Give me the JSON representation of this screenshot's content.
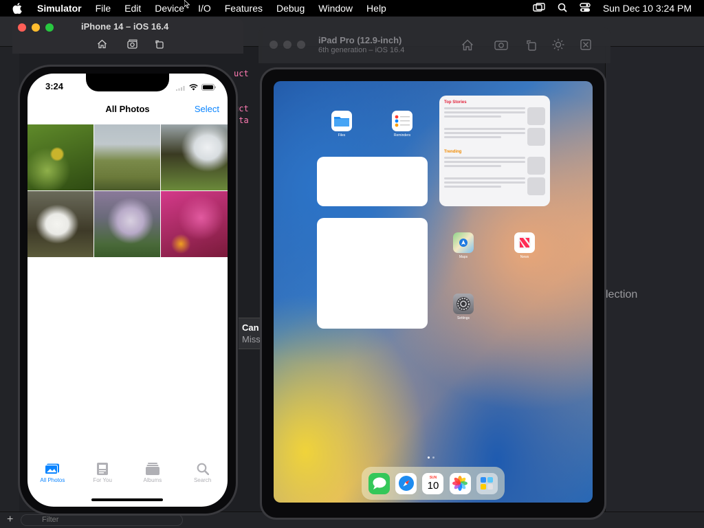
{
  "menubar": {
    "app_name": "Simulator",
    "items": [
      "File",
      "Edit",
      "Device",
      "I/O",
      "Features",
      "Debug",
      "Window",
      "Help"
    ],
    "clock": "Sun Dec 10  3:24 PM"
  },
  "xcode": {
    "code_lines": [
      "uct ",
      "",
      "",
      "uct ",
      " sta",
      "",
      " }"
    ],
    "canvas_error": {
      "title": "Can",
      "subtitle": "Miss"
    },
    "inspector_text": "lection",
    "filter_placeholder": "Filter"
  },
  "iphone_window": {
    "title": "iPhone 14 – iOS 16.4"
  },
  "iphone": {
    "time": "3:24",
    "nav_title": "All Photos",
    "select_label": "Select",
    "photos": [
      {
        "name": "leaves",
        "colors": [
          "#5f8a2a",
          "#c9b42c",
          "#2e4a12"
        ]
      },
      {
        "name": "hillside",
        "colors": [
          "#8a9aa8",
          "#6b7a3a",
          "#c0c8cc"
        ]
      },
      {
        "name": "waterfall-cliff",
        "colors": [
          "#d8dde0",
          "#3a3a22",
          "#6b8a3a"
        ]
      },
      {
        "name": "waterfall-rocks",
        "colors": [
          "#eaeae6",
          "#3e3a28",
          "#6a6a5a"
        ]
      },
      {
        "name": "waterfall-valley",
        "colors": [
          "#b8aac8",
          "#4a6a3a",
          "#8a7a9a"
        ]
      },
      {
        "name": "flowers",
        "colors": [
          "#d43a8a",
          "#7a1a3a",
          "#f0a020"
        ]
      }
    ],
    "tabs": [
      {
        "label": "All Photos",
        "active": true
      },
      {
        "label": "For You",
        "active": false
      },
      {
        "label": "Albums",
        "active": false
      },
      {
        "label": "Search",
        "active": false
      }
    ]
  },
  "ipad_window": {
    "title": "iPad Pro (12.9-inch)",
    "subtitle": "6th generation – iOS 16.4"
  },
  "ipad": {
    "apps": [
      {
        "label": "Files",
        "icon": "files-icon"
      },
      {
        "label": "Reminders",
        "icon": "reminders-icon"
      },
      {
        "label": "Maps",
        "icon": "maps-icon"
      },
      {
        "label": "News",
        "icon": "news-icon"
      },
      {
        "label": "Settings",
        "icon": "settings-icon"
      }
    ],
    "news_widget": {
      "top_stories": "Top Stories",
      "trending": "Trending"
    },
    "dock": [
      {
        "icon": "messages-icon"
      },
      {
        "icon": "safari-icon"
      },
      {
        "icon": "calendar-icon",
        "day": "SUN",
        "date": "10"
      },
      {
        "icon": "photos-icon"
      },
      {
        "icon": "app-library-icon"
      }
    ]
  }
}
